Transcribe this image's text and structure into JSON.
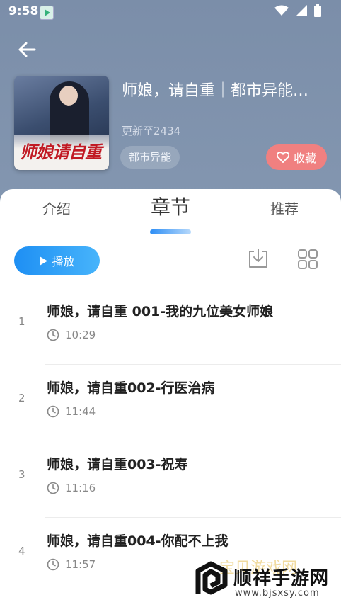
{
  "status_bar": {
    "time": "9:58"
  },
  "book": {
    "cover_title": "师娘请自重",
    "title": "师娘，请自重｜都市异能…",
    "update": "更新至2434",
    "genre": "都市异能",
    "favorite_label": "收藏"
  },
  "tabs": [
    {
      "label": "介绍"
    },
    {
      "label": "章节"
    },
    {
      "label": "推荐"
    }
  ],
  "toolbar": {
    "play_label": "播放"
  },
  "chapters": [
    {
      "num": "1",
      "title": "师娘，请自重 001-我的九位美女师娘",
      "duration": "10:29"
    },
    {
      "num": "2",
      "title": "师娘，请自重002-行医治病",
      "duration": "11:44"
    },
    {
      "num": "3",
      "title": "师娘，请自重003-祝寿",
      "duration": "11:16"
    },
    {
      "num": "4",
      "title": "师娘，请自重004-你配不上我",
      "duration": "11:57"
    }
  ],
  "watermark": {
    "brand": "顺祥手游网",
    "url": "www.bjsxsy.com",
    "faded": "宝贝游戏网"
  },
  "colors": {
    "accent": "#2d8ef5",
    "favorite": "#f08080",
    "header": "#7d90ab"
  }
}
